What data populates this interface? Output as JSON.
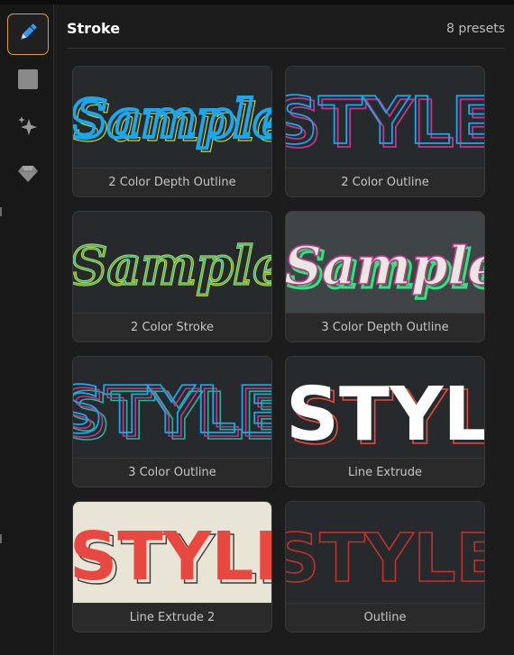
{
  "panel": {
    "title": "Stroke",
    "preset_count": "8 presets"
  },
  "sidebar": {
    "tools": [
      {
        "name": "stroke-tool",
        "icon": "pen-icon",
        "active": true
      },
      {
        "name": "fill-tool",
        "icon": "square-icon",
        "active": false
      },
      {
        "name": "effects-tool",
        "icon": "sparkle-icon",
        "active": false
      },
      {
        "name": "premium-tool",
        "icon": "diamond-icon",
        "active": false
      }
    ]
  },
  "presets": [
    {
      "label": "2 Color Depth Outline",
      "preview_text": "Sample"
    },
    {
      "label": "2 Color Outline",
      "preview_text": "STYLE"
    },
    {
      "label": "2 Color Stroke",
      "preview_text": "Sample"
    },
    {
      "label": "3 Color Depth Outline",
      "preview_text": "Sample"
    },
    {
      "label": "3 Color Outline",
      "preview_text": "STYLE"
    },
    {
      "label": "Line Extrude",
      "preview_text": "STYLE"
    },
    {
      "label": "Line Extrude 2",
      "preview_text": "STYLE"
    },
    {
      "label": "Outline",
      "preview_text": "STYLE"
    }
  ],
  "colors": {
    "accent_active": "#e0a030",
    "pen_blue": "#2f9bf0",
    "cyan": "#1aa7ec",
    "yellow_green": "#c8d23c",
    "magenta": "#c2368c",
    "green": "#3ddc84",
    "red": "#e8483f",
    "cream": "#e8e4d6"
  }
}
